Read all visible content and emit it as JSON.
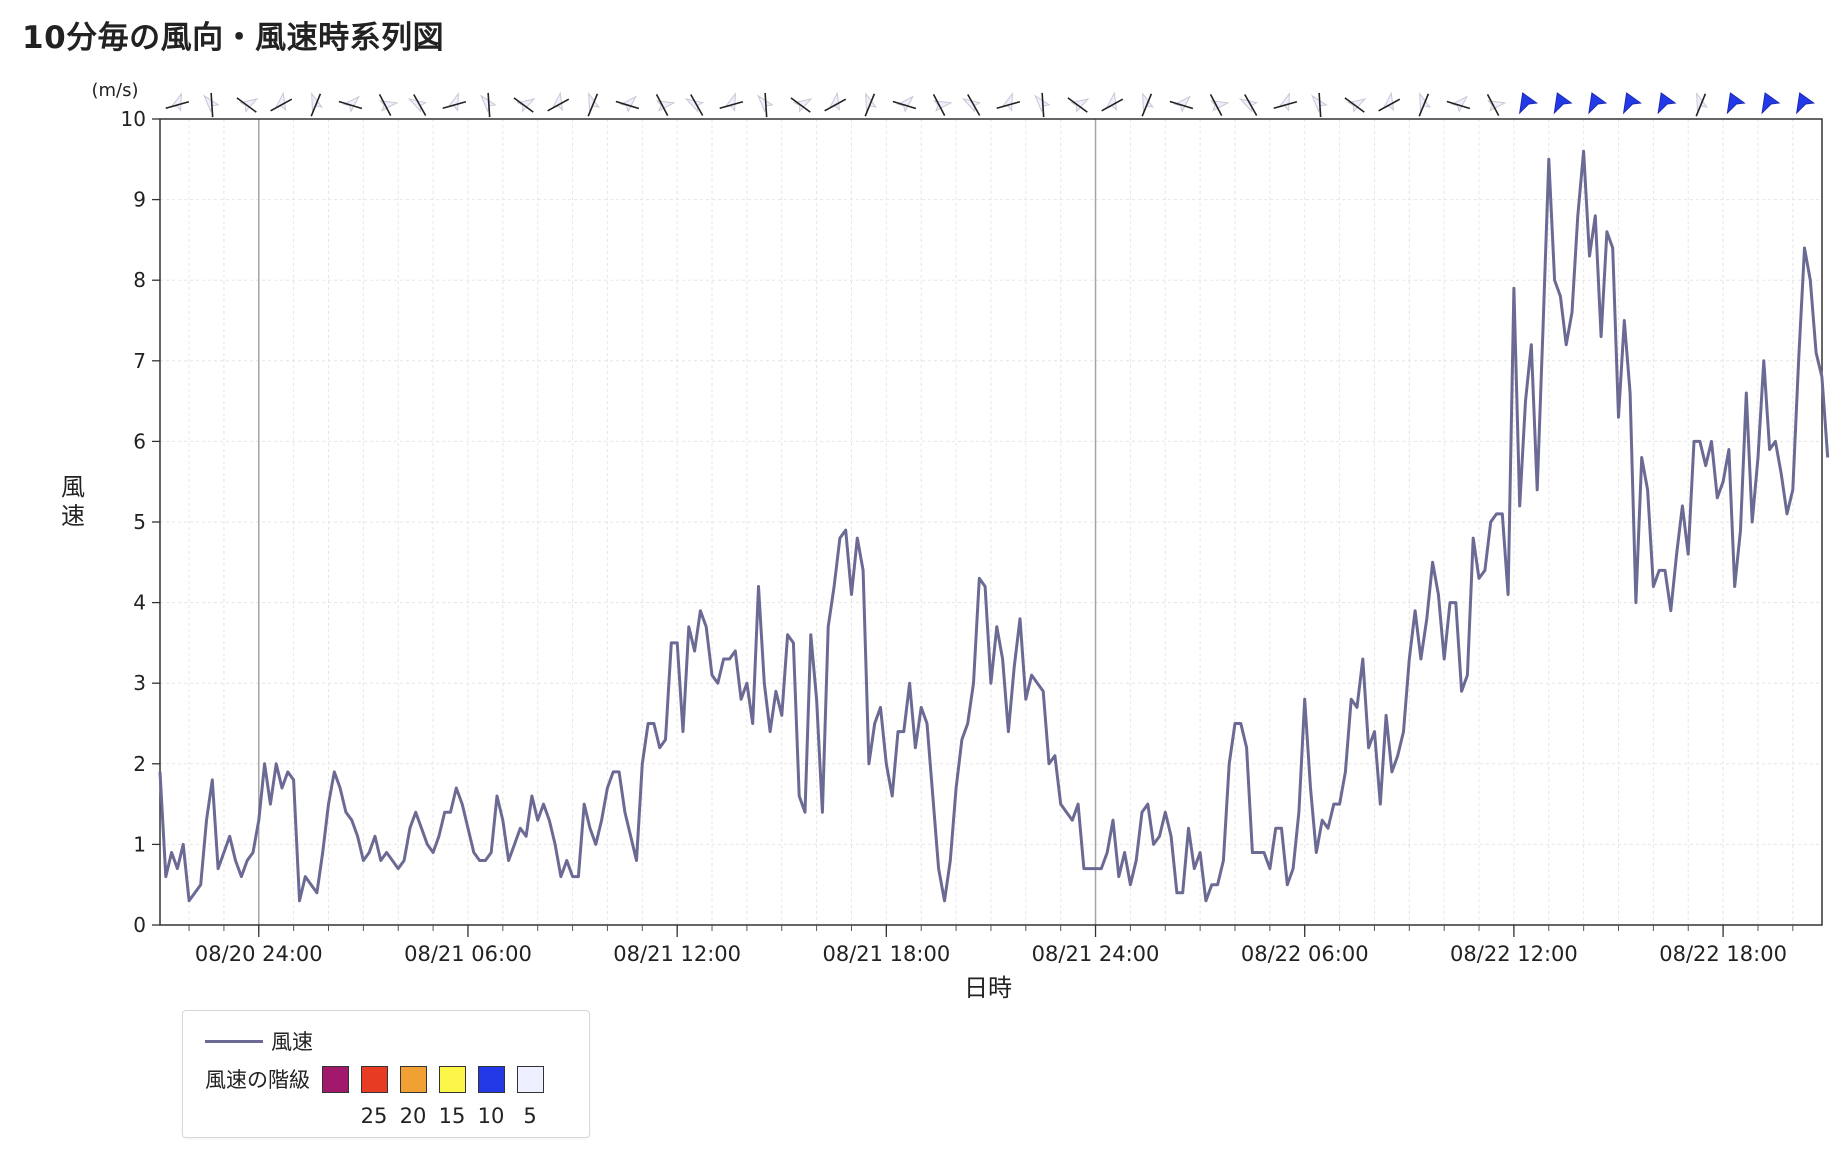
{
  "title": "10分毎の風向・風速時系列図",
  "chart_data": {
    "type": "line",
    "y_unit": "(m/s)",
    "ylabel": "風速",
    "xlabel": "日時",
    "ylim": [
      0,
      10
    ],
    "yticks": [
      0,
      1,
      2,
      3,
      4,
      5,
      6,
      7,
      8,
      9,
      10
    ],
    "x_start": "08/20 21:10",
    "x_step_minutes": 10,
    "x_tick_labels": [
      "08/20 24:00",
      "08/21 06:00",
      "08/21 12:00",
      "08/21 18:00",
      "08/21 24:00",
      "08/22 06:00",
      "08/22 12:00",
      "08/22 18:00"
    ],
    "x_tick_offsets_hours": [
      2.833,
      8.833,
      14.833,
      20.833,
      26.833,
      32.833,
      38.833,
      44.833
    ],
    "x_range_hours": [
      0,
      47.67
    ],
    "day_boundaries_hours": [
      2.833,
      26.833
    ],
    "grid": true,
    "series": [
      {
        "name": "風速",
        "color": "#6b6a94",
        "values": [
          1.9,
          0.6,
          0.9,
          0.7,
          1.0,
          0.3,
          0.4,
          0.5,
          1.3,
          1.8,
          0.7,
          0.9,
          1.1,
          0.8,
          0.6,
          0.8,
          0.9,
          1.3,
          2.0,
          1.5,
          2.0,
          1.7,
          1.9,
          1.8,
          0.3,
          0.6,
          0.5,
          0.4,
          0.9,
          1.5,
          1.9,
          1.7,
          1.4,
          1.3,
          1.1,
          0.8,
          0.9,
          1.1,
          0.8,
          0.9,
          0.8,
          0.7,
          0.8,
          1.2,
          1.4,
          1.2,
          1.0,
          0.9,
          1.1,
          1.4,
          1.4,
          1.7,
          1.5,
          1.2,
          0.9,
          0.8,
          0.8,
          0.9,
          1.6,
          1.3,
          0.8,
          1.0,
          1.2,
          1.1,
          1.6,
          1.3,
          1.5,
          1.3,
          1.0,
          0.6,
          0.8,
          0.6,
          0.6,
          1.5,
          1.2,
          1.0,
          1.3,
          1.7,
          1.9,
          1.9,
          1.4,
          1.1,
          0.8,
          2.0,
          2.5,
          2.5,
          2.2,
          2.3,
          3.5,
          3.5,
          2.4,
          3.7,
          3.4,
          3.9,
          3.7,
          3.1,
          3.0,
          3.3,
          3.3,
          3.4,
          2.8,
          3.0,
          2.5,
          4.2,
          3.0,
          2.4,
          2.9,
          2.6,
          3.6,
          3.5,
          1.6,
          1.4,
          3.6,
          2.8,
          1.4,
          3.7,
          4.2,
          4.8,
          4.9,
          4.1,
          4.8,
          4.4,
          2.0,
          2.5,
          2.7,
          2.0,
          1.6,
          2.4,
          2.4,
          3.0,
          2.2,
          2.7,
          2.5,
          1.6,
          0.7,
          0.3,
          0.8,
          1.7,
          2.3,
          2.5,
          3.0,
          4.3,
          4.2,
          3.0,
          3.7,
          3.3,
          2.4,
          3.2,
          3.8,
          2.8,
          3.1,
          3.0,
          2.9,
          2.0,
          2.1,
          1.5,
          1.4,
          1.3,
          1.5,
          0.7,
          0.7,
          0.7,
          0.7,
          0.9,
          1.3,
          0.6,
          0.9,
          0.5,
          0.8,
          1.4,
          1.5,
          1.0,
          1.1,
          1.4,
          1.1,
          0.4,
          0.4,
          1.2,
          0.7,
          0.9,
          0.3,
          0.5,
          0.5,
          0.8,
          2.0,
          2.5,
          2.5,
          2.2,
          0.9,
          0.9,
          0.9,
          0.7,
          1.2,
          1.2,
          0.5,
          0.7,
          1.4,
          2.8,
          1.7,
          0.9,
          1.3,
          1.2,
          1.5,
          1.5,
          1.9,
          2.8,
          2.7,
          3.3,
          2.2,
          2.4,
          1.5,
          2.6,
          1.9,
          2.1,
          2.4,
          3.3,
          3.9,
          3.3,
          3.8,
          4.5,
          4.1,
          3.3,
          4.0,
          4.0,
          2.9,
          3.1,
          4.8,
          4.3,
          4.4,
          5.0,
          5.1,
          5.1,
          4.1,
          7.9,
          5.2,
          6.5,
          7.2,
          5.4,
          7.4,
          9.5,
          8.0,
          7.8,
          7.2,
          7.6,
          8.8,
          9.6,
          8.3,
          8.8,
          7.3,
          8.6,
          8.4,
          6.3,
          7.5,
          6.6,
          4.0,
          5.8,
          5.4,
          4.2,
          4.4,
          4.4,
          3.9,
          4.6,
          5.2,
          4.6,
          6.0,
          6.0,
          5.7,
          6.0,
          5.3,
          5.5,
          5.9,
          4.2,
          4.9,
          6.6,
          5.0,
          5.8,
          7.0,
          5.9,
          6.0,
          5.6,
          5.1,
          5.4,
          7.0,
          8.4,
          8.0,
          7.1,
          6.8,
          5.8
        ]
      }
    ],
    "wind_arrows": {
      "count": 48,
      "level10_start_index": 39,
      "level10_color": "#2339e8",
      "level5_color": "#eef0ff",
      "level10_skip_indices": [
        44
      ]
    },
    "legend": {
      "series_label": "風速",
      "class_label": "風速の階級",
      "class_colors": [
        "#a0196b",
        "#e83b24",
        "#f1a133",
        "#fbf648",
        "#2339e8",
        "#eef0ff"
      ],
      "class_values": [
        "25",
        "20",
        "15",
        "10",
        "5"
      ]
    }
  }
}
